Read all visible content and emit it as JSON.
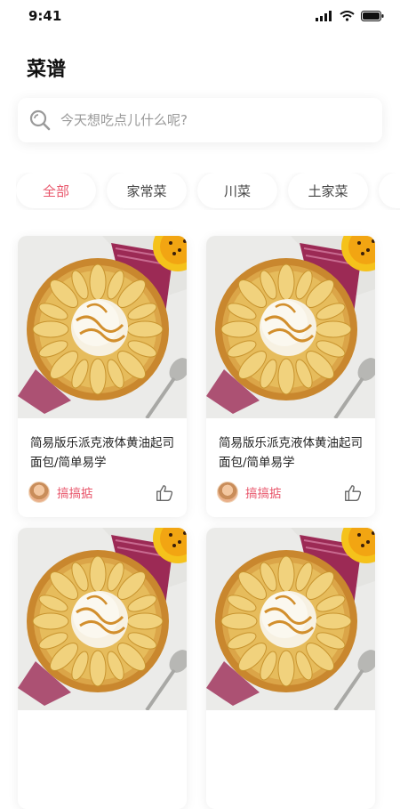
{
  "status_bar": {
    "time": "9:41"
  },
  "page": {
    "title": "菜谱"
  },
  "search": {
    "placeholder": "今天想吃点儿什么呢?"
  },
  "categories": [
    {
      "label": "全部",
      "active": true
    },
    {
      "label": "家常菜",
      "active": false
    },
    {
      "label": "川菜",
      "active": false
    },
    {
      "label": "土家菜",
      "active": false
    }
  ],
  "recipes": [
    {
      "title": "简易版乐派克液体黄油起司面包/简单易学",
      "author": "搞搞掂"
    },
    {
      "title": "简易版乐派克液体黄油起司面包/简单易学",
      "author": "搞搞掂"
    },
    {
      "title": "",
      "author": ""
    },
    {
      "title": "",
      "author": ""
    }
  ],
  "colors": {
    "accent": "#e8566b"
  }
}
